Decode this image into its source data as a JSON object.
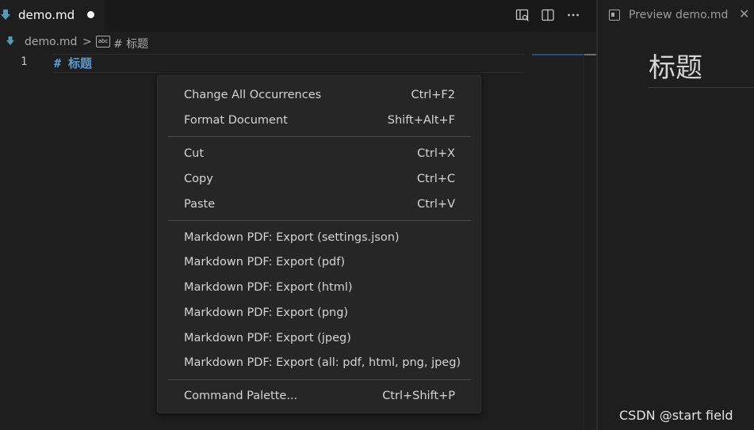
{
  "editor": {
    "tab": {
      "label": "demo.md",
      "icon": "markdown-icon",
      "dirty": true
    },
    "actions": [
      "open-preview-icon",
      "split-editor-icon",
      "more-actions-icon"
    ],
    "breadcrumb": {
      "file": "demo.md",
      "separator": ">",
      "symbol_icon": "abc-icon",
      "symbol": "# 标题"
    },
    "line_number": "1",
    "code": "# 标题",
    "colors": {
      "heading": "#569cd6",
      "background": "#1e1e1e",
      "tab_bar": "#181818"
    }
  },
  "preview": {
    "tab_label": "Preview demo.md",
    "close_glyph": "✕",
    "heading": "标题",
    "watermark": "CSDN @start field"
  },
  "context_menu": {
    "items": [
      {
        "label": "Change All Occurrences",
        "shortcut": "Ctrl+F2"
      },
      {
        "label": "Format Document",
        "shortcut": "Shift+Alt+F"
      },
      {
        "label": "Cut",
        "shortcut": "Ctrl+X"
      },
      {
        "label": "Copy",
        "shortcut": "Ctrl+C"
      },
      {
        "label": "Paste",
        "shortcut": "Ctrl+V"
      },
      {
        "label": "Markdown PDF: Export (settings.json)",
        "shortcut": ""
      },
      {
        "label": "Markdown PDF: Export (pdf)",
        "shortcut": ""
      },
      {
        "label": "Markdown PDF: Export (html)",
        "shortcut": ""
      },
      {
        "label": "Markdown PDF: Export (png)",
        "shortcut": ""
      },
      {
        "label": "Markdown PDF: Export (jpeg)",
        "shortcut": ""
      },
      {
        "label": "Markdown PDF: Export (all: pdf, html, png, jpeg)",
        "shortcut": ""
      },
      {
        "label": "Command Palette...",
        "shortcut": "Ctrl+Shift+P"
      }
    ]
  }
}
